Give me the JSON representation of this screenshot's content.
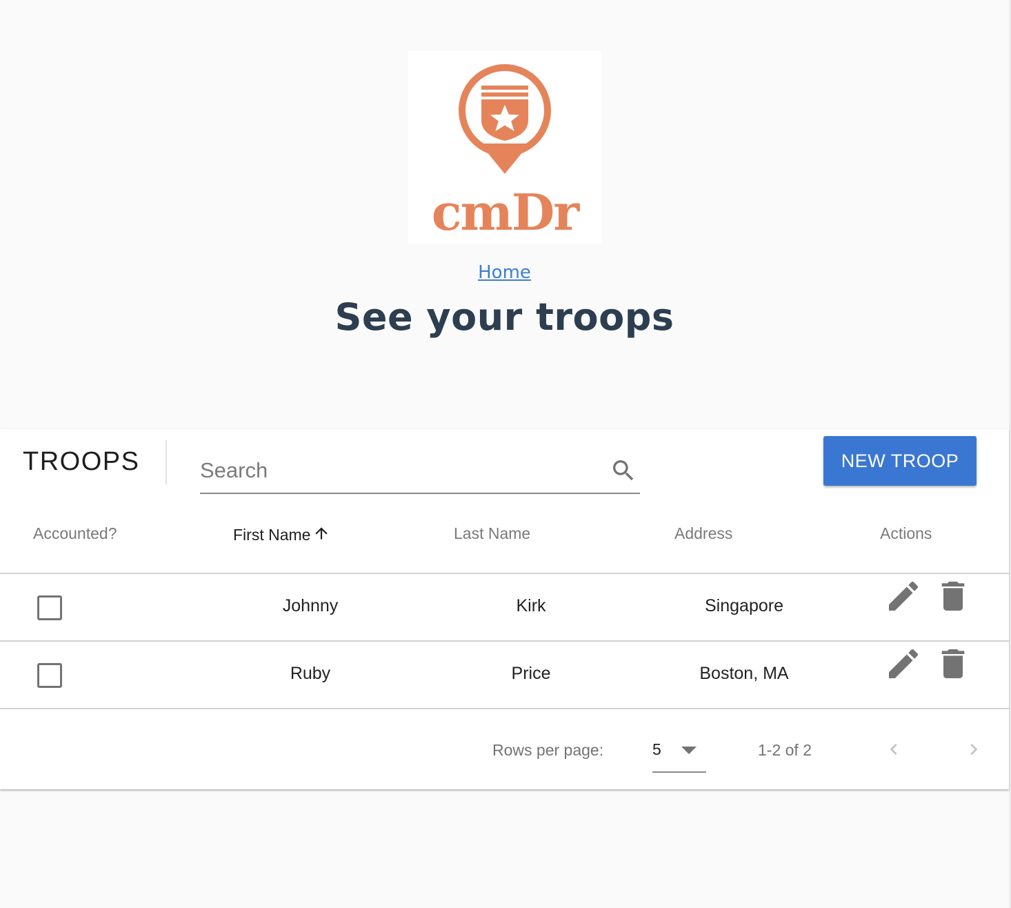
{
  "header": {
    "logo_text": "cmDr",
    "home_link": "Home",
    "title": "See your troops"
  },
  "toolbar": {
    "title": "TROOPS",
    "search_placeholder": "Search",
    "new_button_label": "NEW TROOP"
  },
  "table": {
    "columns": {
      "accounted": "Accounted?",
      "first_name": "First Name",
      "last_name": "Last Name",
      "address": "Address",
      "actions": "Actions"
    },
    "sort": {
      "column": "first_name",
      "direction": "ascending"
    },
    "rows": [
      {
        "accounted": false,
        "first_name": "Johnny",
        "last_name": "Kirk",
        "address": "Singapore"
      },
      {
        "accounted": false,
        "first_name": "Ruby",
        "last_name": "Price",
        "address": "Boston, MA"
      }
    ]
  },
  "pagination": {
    "rows_per_page_label": "Rows per page:",
    "rows_per_page": "5",
    "range": "1-2 of 2"
  },
  "colors": {
    "brand_orange": "#e5845a",
    "primary_blue": "#3a77d2",
    "title_navy": "#2c3e50",
    "icon_gray": "#737373"
  }
}
